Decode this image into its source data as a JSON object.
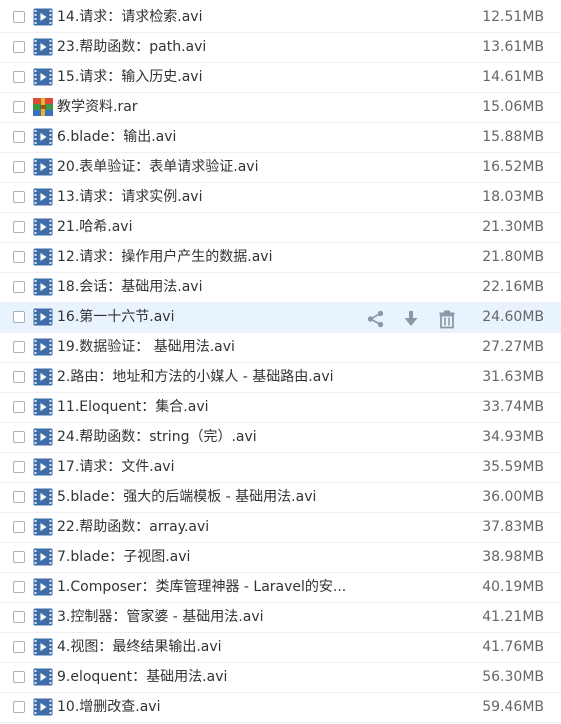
{
  "colors": {
    "video_icon": "#3f6da8",
    "action_icon": "#8a98a8",
    "hover_row": "#e9f3fd"
  },
  "icons": {
    "video": "video-file-icon",
    "archive": "rar-archive-icon",
    "share": "share-icon",
    "download": "download-icon",
    "delete": "trash-icon"
  },
  "files": [
    {
      "name": "14.请求：请求检索.avi",
      "size": "12.51MB",
      "type": "video"
    },
    {
      "name": "23.帮助函数：path.avi",
      "size": "13.61MB",
      "type": "video"
    },
    {
      "name": "15.请求：输入历史.avi",
      "size": "14.61MB",
      "type": "video"
    },
    {
      "name": "教学资料.rar",
      "size": "15.06MB",
      "type": "archive"
    },
    {
      "name": "6.blade：输出.avi",
      "size": "15.88MB",
      "type": "video"
    },
    {
      "name": "20.表单验证：表单请求验证.avi",
      "size": "16.52MB",
      "type": "video"
    },
    {
      "name": "13.请求：请求实例.avi",
      "size": "18.03MB",
      "type": "video"
    },
    {
      "name": "21.哈希.avi",
      "size": "21.30MB",
      "type": "video"
    },
    {
      "name": "12.请求：操作用户产生的数据.avi",
      "size": "21.80MB",
      "type": "video"
    },
    {
      "name": "18.会话：基础用法.avi",
      "size": "22.16MB",
      "type": "video"
    },
    {
      "name": "16.第一十六节.avi",
      "size": "24.60MB",
      "type": "video",
      "hover": true
    },
    {
      "name": "19.数据验证： 基础用法.avi",
      "size": "27.27MB",
      "type": "video"
    },
    {
      "name": "2.路由：地址和方法的小媒人 - 基础路由.avi",
      "size": "31.63MB",
      "type": "video"
    },
    {
      "name": "11.Eloquent：集合.avi",
      "size": "33.74MB",
      "type": "video"
    },
    {
      "name": "24.帮助函数：string（完）.avi",
      "size": "34.93MB",
      "type": "video"
    },
    {
      "name": "17.请求：文件.avi",
      "size": "35.59MB",
      "type": "video"
    },
    {
      "name": "5.blade：强大的后端模板 - 基础用法.avi",
      "size": "36.00MB",
      "type": "video"
    },
    {
      "name": "22.帮助函数：array.avi",
      "size": "37.83MB",
      "type": "video"
    },
    {
      "name": "7.blade：子视图.avi",
      "size": "38.98MB",
      "type": "video"
    },
    {
      "name": "1.Composer：类库管理神器 - Laravel的安...",
      "size": "40.19MB",
      "type": "video"
    },
    {
      "name": "3.控制器：管家婆 - 基础用法.avi",
      "size": "41.21MB",
      "type": "video"
    },
    {
      "name": "4.视图：最终结果输出.avi",
      "size": "41.76MB",
      "type": "video"
    },
    {
      "name": "9.eloquent：基础用法.avi",
      "size": "56.30MB",
      "type": "video"
    },
    {
      "name": "10.增删改查.avi",
      "size": "59.46MB",
      "type": "video"
    }
  ]
}
